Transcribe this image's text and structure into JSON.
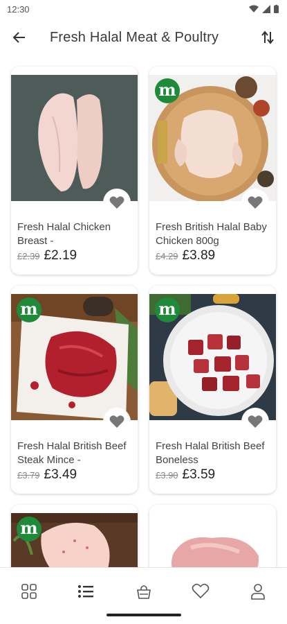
{
  "status_bar": {
    "time": "12:30"
  },
  "header": {
    "title": "Fresh Halal Meat & Poultry"
  },
  "badge_letter": "m",
  "accent_color": "#1e8a3a",
  "products": [
    {
      "name": "Fresh Halal Chicken Breast -",
      "old_price": "£2.39",
      "price": "£2.19",
      "has_badge": false,
      "image": "chicken-breast"
    },
    {
      "name": "Fresh British Halal Baby Chicken 800g",
      "old_price": "£4.29",
      "price": "£3.89",
      "has_badge": true,
      "image": "whole-baby-chicken"
    },
    {
      "name": "Fresh Halal British Beef Steak Mince -",
      "old_price": "£3.79",
      "price": "£3.49",
      "has_badge": true,
      "image": "beef-mince"
    },
    {
      "name": "Fresh Halal British Beef Boneless",
      "old_price": "£3.90",
      "price": "£3.59",
      "has_badge": true,
      "image": "beef-cubes"
    },
    {
      "name": "",
      "old_price": "",
      "price": "",
      "has_badge": true,
      "image": "chicken-thigh"
    },
    {
      "name": "",
      "old_price": "",
      "price": "",
      "has_badge": false,
      "image": "raw-meat"
    }
  ],
  "bottom_nav": [
    "grid-icon",
    "list-icon",
    "bag-icon",
    "heart-icon",
    "profile-icon"
  ]
}
